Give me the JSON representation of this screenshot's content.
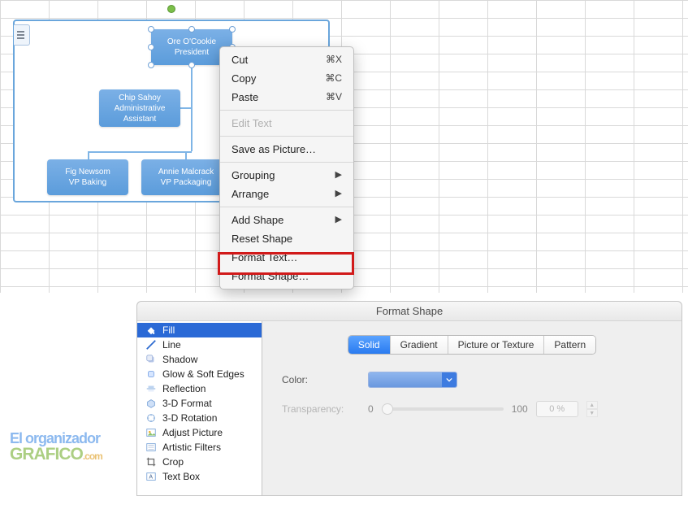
{
  "org_chart": {
    "president": {
      "name": "Ore O'Cookie",
      "title": "President"
    },
    "admin": {
      "name": "Chip Sahoy",
      "title": "Administrative Assistant"
    },
    "baking": {
      "name": "Fig Newsom",
      "title": "VP Baking"
    },
    "packaging": {
      "name": "Annie Malcrack",
      "title": "VP Packaging"
    }
  },
  "context_menu": {
    "cut": {
      "label": "Cut",
      "shortcut": "⌘X"
    },
    "copy": {
      "label": "Copy",
      "shortcut": "⌘C"
    },
    "paste": {
      "label": "Paste",
      "shortcut": "⌘V"
    },
    "edit_text": {
      "label": "Edit Text"
    },
    "save_pic": {
      "label": "Save as Picture…"
    },
    "grouping": {
      "label": "Grouping"
    },
    "arrange": {
      "label": "Arrange"
    },
    "add_shape": {
      "label": "Add Shape"
    },
    "reset_shape": {
      "label": "Reset Shape"
    },
    "fmt_text": {
      "label": "Format Text…"
    },
    "fmt_shape": {
      "label": "Format Shape…"
    }
  },
  "dialog": {
    "title": "Format Shape",
    "sidebar": {
      "items": [
        "Fill",
        "Line",
        "Shadow",
        "Glow & Soft Edges",
        "Reflection",
        "3-D Format",
        "3-D Rotation",
        "Adjust Picture",
        "Artistic Filters",
        "Crop",
        "Text Box"
      ]
    },
    "tabs": {
      "solid": "Solid",
      "gradient": "Gradient",
      "pic_tex": "Picture or Texture",
      "pattern": "Pattern"
    },
    "color_label": "Color:",
    "transparency_label": "Transparency:",
    "transparency_min": "0",
    "transparency_max": "100",
    "transparency_value": "0 %"
  },
  "watermark": {
    "line1": "El organizador",
    "line2": "GRAFICO",
    "suffix": ".com"
  }
}
